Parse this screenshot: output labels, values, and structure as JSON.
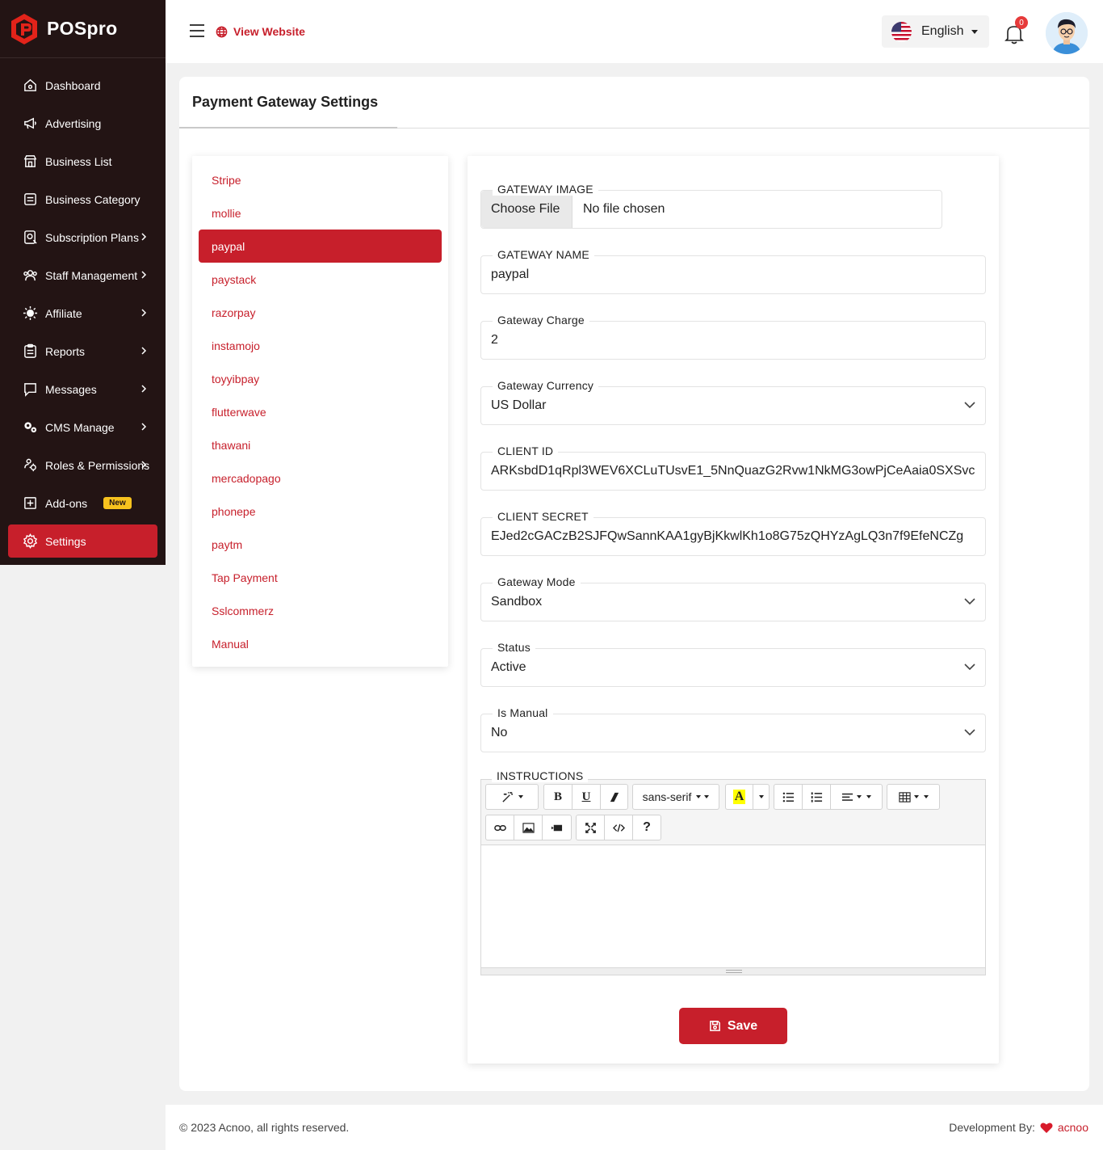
{
  "brand": {
    "name": "POSpro"
  },
  "sidebar": {
    "items": [
      {
        "label": "Dashboard",
        "icon": "home-icon",
        "chevron": false
      },
      {
        "label": "Advertising",
        "icon": "megaphone-icon",
        "chevron": false
      },
      {
        "label": "Business List",
        "icon": "store-icon",
        "chevron": false
      },
      {
        "label": "Business Category",
        "icon": "category-icon",
        "chevron": false
      },
      {
        "label": "Subscription Plans",
        "icon": "plans-icon",
        "chevron": true
      },
      {
        "label": "Staff Management",
        "icon": "users-icon",
        "chevron": true
      },
      {
        "label": "Affiliate",
        "icon": "affiliate-icon",
        "chevron": true
      },
      {
        "label": "Reports",
        "icon": "reports-icon",
        "chevron": true
      },
      {
        "label": "Messages",
        "icon": "message-icon",
        "chevron": true
      },
      {
        "label": "CMS Manage",
        "icon": "gears-icon",
        "chevron": true
      },
      {
        "label": "Roles & Permissions",
        "icon": "roles-icon",
        "chevron": true
      },
      {
        "label": "Add-ons",
        "icon": "plus-square-icon",
        "chevron": false,
        "badge": "New"
      },
      {
        "label": "Settings",
        "icon": "gear-icon",
        "chevron": false,
        "active": true
      }
    ]
  },
  "header": {
    "view_website": "View Website",
    "language": "English",
    "notification_count": "0"
  },
  "page": {
    "title": "Payment Gateway Settings"
  },
  "gateways": {
    "items": [
      "Stripe",
      "mollie",
      "paypal",
      "paystack",
      "razorpay",
      "instamojo",
      "toyyibpay",
      "flutterwave",
      "thawani",
      "mercadopago",
      "phonepe",
      "paytm",
      "Tap Payment",
      "Sslcommerz",
      "Manual"
    ],
    "active_index": 2
  },
  "form": {
    "gateway_image": {
      "label": "GATEWAY IMAGE",
      "button": "Choose File",
      "status": "No file chosen"
    },
    "gateway_name": {
      "label": "GATEWAY NAME",
      "value": "paypal"
    },
    "gateway_charge": {
      "label": "Gateway Charge",
      "value": "2"
    },
    "gateway_currency": {
      "label": "Gateway Currency",
      "value": "US Dollar"
    },
    "client_id": {
      "label": "CLIENT ID",
      "value": "ARKsbdD1qRpl3WEV6XCLuTUsvE1_5NnQuazG2Rvw1NkMG3owPjCeAaia0SXSvc"
    },
    "client_secret": {
      "label": "CLIENT SECRET",
      "value": "EJed2cGACzB2SJFQwSannKAA1gyBjKkwlKh1o8G75zQHYzAgLQ3n7f9EfeNCZg"
    },
    "gateway_mode": {
      "label": "Gateway Mode",
      "value": "Sandbox"
    },
    "status": {
      "label": "Status",
      "value": "Active"
    },
    "is_manual": {
      "label": "Is Manual",
      "value": "No"
    },
    "instructions": {
      "label": "INSTRUCTIONS",
      "font_name": "sans-serif"
    },
    "save_label": "Save"
  },
  "footer": {
    "copyright": "© 2023 Acnoo, all rights reserved.",
    "dev_by": "Development By:",
    "dev_link": "acnoo"
  },
  "colors": {
    "accent": "#c71f2b",
    "sidebar_bg": "#231414",
    "badge": "#f7c21e"
  }
}
